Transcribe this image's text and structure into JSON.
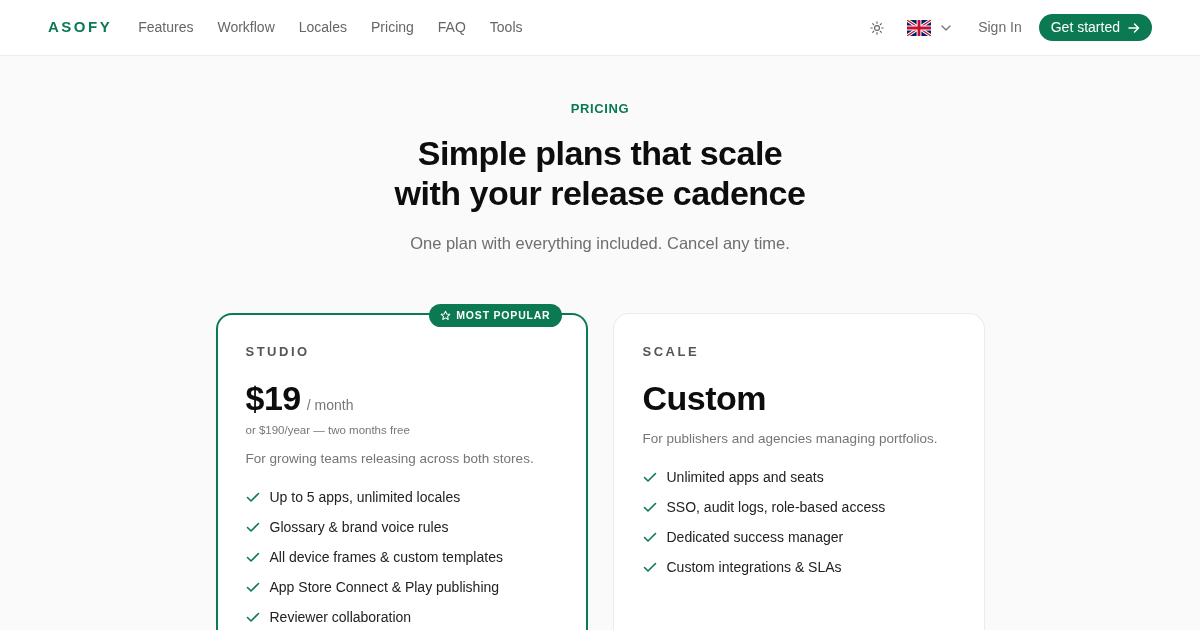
{
  "nav": {
    "logo": "ASOFY",
    "links": [
      "Features",
      "Workflow",
      "Locales",
      "Pricing",
      "FAQ",
      "Tools"
    ],
    "sign_in": "Sign In",
    "cta": "Get started"
  },
  "hero": {
    "eyebrow": "PRICING",
    "title": "Simple plans that scale with your release cadence",
    "subtitle": "One plan with everything included. Cancel any time."
  },
  "plans": [
    {
      "name": "STUDIO",
      "featured": true,
      "badge": "MOST POPULAR",
      "price": "$19",
      "period": "/ month",
      "note": "or $190/year — two months free",
      "description": "For growing teams releasing across both stores.",
      "features": [
        "Up to 5 apps, unlimited locales",
        "Glossary & brand voice rules",
        "All device frames & custom templates",
        "App Store Connect & Play publishing",
        "Reviewer collaboration"
      ]
    },
    {
      "name": "SCALE",
      "featured": false,
      "price": "Custom",
      "description": "For publishers and agencies managing portfolios.",
      "features": [
        "Unlimited apps and seats",
        "SSO, audit logs, role-based access",
        "Dedicated success manager",
        "Custom integrations & SLAs"
      ]
    }
  ]
}
